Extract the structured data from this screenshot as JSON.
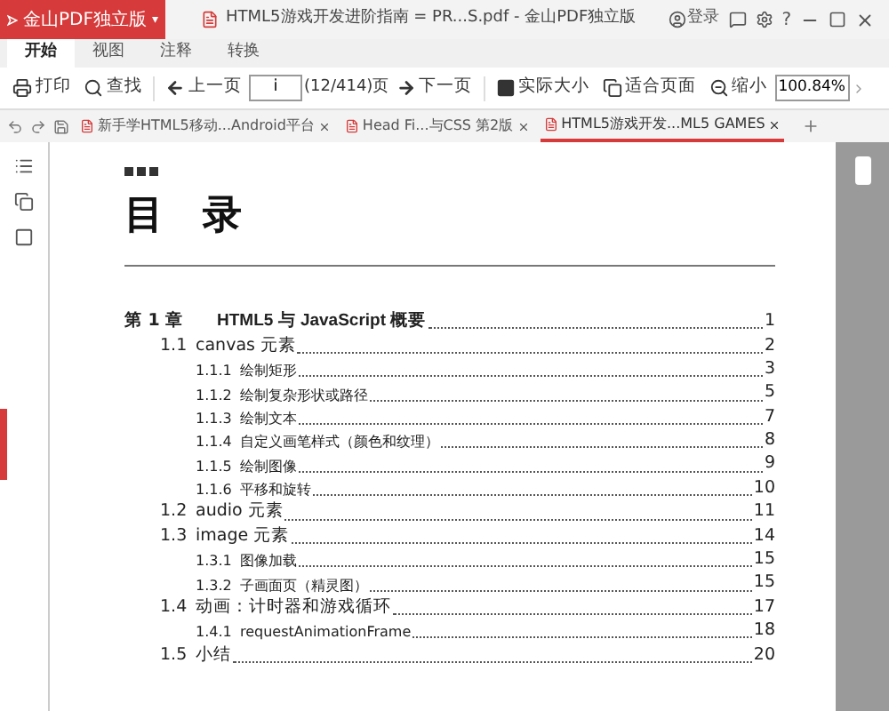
{
  "app_menu": {
    "label": "金山PDF独立版",
    "caret": "▾"
  },
  "window": {
    "title": "HTML5游戏开发进阶指南 = PR...S.pdf - 金山PDF独立版",
    "login": "登录",
    "help": "?"
  },
  "ribbon_tabs": [
    {
      "label": "开始",
      "selected": true
    },
    {
      "label": "视图",
      "selected": false
    },
    {
      "label": "注释",
      "selected": false
    },
    {
      "label": "转换",
      "selected": false
    }
  ],
  "toolbar": {
    "print": "打印",
    "find": "查找",
    "prev": "上一页",
    "page_value": "i",
    "page_count": "(12/414)页",
    "next": "下一页",
    "actual_size": "实际大小",
    "fit_page": "适合页面",
    "zoom_out": "缩小",
    "zoom_value": "100.84%"
  },
  "doc_tabs": [
    {
      "label": "新手学HTML5移动...Android平台",
      "selected": false
    },
    {
      "label": "Head Fi...与CSS 第2版",
      "selected": false
    },
    {
      "label": "HTML5游戏开发...ML5 GAMES",
      "selected": true
    }
  ],
  "page": {
    "heading": "目　录",
    "toc": [
      {
        "number": "第 1 章",
        "title": "HTML5 与 JavaScript 概要",
        "page": "1",
        "children": [
          {
            "number": "1.1",
            "title": "canvas 元素",
            "page": "2",
            "children": [
              {
                "number": "1.1.1",
                "title": "绘制矩形",
                "page": "3"
              },
              {
                "number": "1.1.2",
                "title": "绘制复杂形状或路径",
                "page": "5"
              },
              {
                "number": "1.1.3",
                "title": "绘制文本",
                "page": "7"
              },
              {
                "number": "1.1.4",
                "title": "自定义画笔样式（颜色和纹理）",
                "page": "8"
              },
              {
                "number": "1.1.5",
                "title": "绘制图像",
                "page": "9"
              },
              {
                "number": "1.1.6",
                "title": "平移和旋转",
                "page": "10"
              }
            ]
          },
          {
            "number": "1.2",
            "title": "audio 元素",
            "page": "11"
          },
          {
            "number": "1.3",
            "title": "image 元素",
            "page": "14",
            "children": [
              {
                "number": "1.3.1",
                "title": "图像加载",
                "page": "15"
              },
              {
                "number": "1.3.2",
                "title": "子画面页（精灵图）",
                "page": "15"
              }
            ]
          },
          {
            "number": "1.4",
            "title": "动画：计时器和游戏循环",
            "page": "17",
            "children": [
              {
                "number": "1.4.1",
                "title": "requestAnimationFrame",
                "page": "18"
              }
            ]
          },
          {
            "number": "1.5",
            "title": "小结",
            "page": "20"
          }
        ]
      }
    ]
  }
}
